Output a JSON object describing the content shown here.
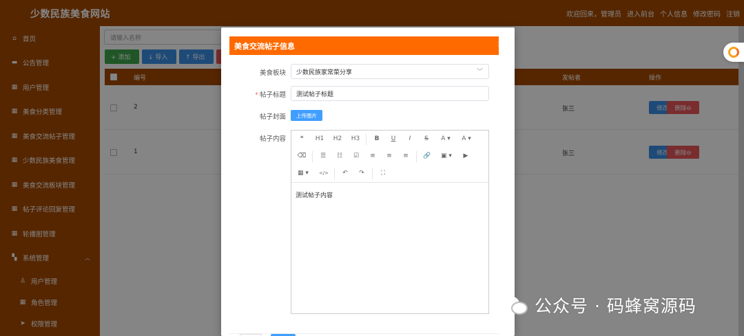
{
  "header": {
    "title": "少数民族美食网站",
    "links": [
      "欢迎回来，管理员",
      "进入前台",
      "个人信息",
      "修改密码",
      "注销"
    ]
  },
  "sidebar": {
    "items": [
      {
        "label": "首页",
        "icon": "home-icon"
      },
      {
        "label": "公告管理",
        "icon": "notice-icon"
      },
      {
        "label": "用户管理",
        "icon": "grid-icon"
      },
      {
        "label": "美食分类管理",
        "icon": "grid-icon"
      },
      {
        "label": "美食交流帖子管理",
        "icon": "grid-icon"
      },
      {
        "label": "少数民族美食管理",
        "icon": "grid-icon"
      },
      {
        "label": "美食交流板块管理",
        "icon": "grid-icon"
      },
      {
        "label": "帖子评论回复管理",
        "icon": "grid-icon"
      },
      {
        "label": "轮播图管理",
        "icon": "grid-icon"
      },
      {
        "label": "系统管理",
        "icon": "apps-icon"
      }
    ],
    "sub_items": [
      {
        "label": "用户管理",
        "icon": "user-icon"
      },
      {
        "label": "角色管理",
        "icon": "grid-icon"
      },
      {
        "label": "权限管理",
        "icon": "send-icon"
      }
    ]
  },
  "main": {
    "search_placeholder": "请输入名称",
    "toolbar": {
      "add": "+ 添加",
      "import": "↓ 导入",
      "export": "↑ 导出"
    },
    "table": {
      "headers": [
        "编号",
        "发帖者",
        "操作"
      ],
      "rows": [
        {
          "id": "2",
          "author": "张三",
          "edit": "修改☑",
          "delete": "删除⊖"
        },
        {
          "id": "1",
          "author": "张三",
          "edit": "修改☑",
          "delete": "删除⊖"
        }
      ]
    }
  },
  "dialog": {
    "title": "美食交流帖子信息",
    "fields": {
      "board_label": "美食板块",
      "board_value": "少数民族家常菜分享",
      "title_label": "帖子标题",
      "title_value": "测试帖子标题",
      "cover_label": "帖子封面",
      "upload_label": "上传图片",
      "content_label": "帖子内容",
      "content_value": "测试帖子内容"
    },
    "editor_toolbar": {
      "row1": [
        "❝",
        "H1",
        "H2",
        "H3",
        "B",
        "U",
        "I",
        "S",
        "A ▾",
        "A ▾"
      ],
      "row2": [
        "⌫",
        "☰",
        "☷",
        "☑",
        "≡",
        "≡",
        "≡",
        "🔗",
        "▣ ▾",
        "▶"
      ],
      "row3": [
        "▦ ▾",
        "</>",
        "↶",
        "↷",
        "⛶"
      ]
    }
  },
  "watermark": {
    "text": "公众号 · 码蜂窝源码"
  },
  "colors": {
    "header_bg": "#a54900",
    "dialog_title_bg": "#ff6a00",
    "primary": "#409eff",
    "danger": "#e8575b",
    "success": "#3ea54b"
  }
}
